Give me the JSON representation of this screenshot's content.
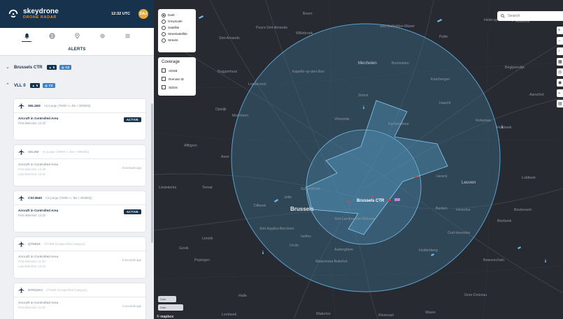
{
  "brand": {
    "name": "skeydrone",
    "sub": "DRONE RADAR"
  },
  "header": {
    "clock": "12:32 UTC",
    "avatar": "DAJ"
  },
  "nav": [
    {
      "icon": "bell-icon"
    },
    {
      "icon": "globe-icon"
    },
    {
      "icon": "pin-icon"
    },
    {
      "icon": "gear-icon"
    },
    {
      "icon": "menu-icon"
    }
  ],
  "alerts_title": "ALERTS",
  "groups": [
    {
      "name": "Brussels CTR",
      "count": "6",
      "cz": "CZ"
    },
    {
      "name": "VLL 0",
      "count": "5",
      "cz": "CZ"
    }
  ],
  "alerts": [
    {
      "callsign": "SEL1ED",
      "category": "A3 (Large (75000 <= lbs < 300000))",
      "type": "Aircraft in Controlled Area",
      "line1": "First detection: 12:22",
      "line2": "",
      "status": "ACTIVE",
      "ago": ""
    },
    {
      "callsign": "SEL8M",
      "category": "A3 (Large (75000 <= lbs < 300000))",
      "type": "Aircraft in Controlled Area",
      "line1": "First detection: 12:28",
      "line2": "Last detection: 12:32",
      "status": "",
      "ago": "6 seconds ago"
    },
    {
      "callsign": "CSC3640",
      "category": "A3 (Large (75000 <= lbs < 300000))",
      "type": "Aircraft in Controlled Area",
      "line1": "First detection: 12:22",
      "line2": "",
      "status": "ACTIVE",
      "ago": ""
    },
    {
      "callsign": "QTN61K",
      "category": "OTHER (Unspecified Category)",
      "type": "Aircraft in Controlled Area",
      "line1": "First detection: 11:33",
      "line2": "Last detection: 12:33",
      "status": "",
      "ago": "5 seconds ago"
    },
    {
      "callsign": "RYR22KV",
      "category": "OTHER (Unspecified Category)",
      "type": "Aircraft in Controlled Area",
      "line1": "First detection: 11:48",
      "line2": "",
      "status": "",
      "ago": "4 seconds ago"
    }
  ],
  "map_style": {
    "options": [
      "Dark",
      "Greyscale",
      "Satellite",
      "Streetsatellite",
      "Streets"
    ],
    "selected": "Dark"
  },
  "coverage": {
    "title": "Coverage",
    "options": [
      "ADSB",
      "Remote ID",
      "SDDS"
    ]
  },
  "search": {
    "placeholder": "Search"
  },
  "tools": [
    "+",
    "−",
    "↑",
    "▦",
    "◎",
    "◉",
    "⌁",
    "▤"
  ],
  "timechips": [
    "Date",
    "Date"
  ],
  "map_labels": {
    "big": [
      "Brussels",
      "Leuven",
      "Mechelen"
    ],
    "places": [
      "Boom",
      "Puurs-Sint-Amands",
      "Willebroek",
      "Sint-Kathelijne-Waver",
      "Putte",
      "Heist-op-den-Berg",
      "Hulshout",
      "Sint-Amands",
      "Buggenhout",
      "Kapelle-op-den-Bos",
      "Londerzeel",
      "Bonheiden",
      "Keerbergen",
      "Begijnendijk",
      "Aarschot",
      "Opwijk",
      "Merchtem",
      "Zemst",
      "Haacht",
      "Rotselaar",
      "Holsbeek",
      "Vilvoorde",
      "Kampenhout",
      "Affligem",
      "Asse",
      "Liedekerke",
      "Ternat",
      "Dilbeek",
      "Sint-Agatha-Berchem",
      "Jette",
      "Schaerbeek",
      "Herent",
      "Bertem",
      "Heverlee",
      "Lubbeek",
      "Ixelles",
      "Sint-Lambrechts-Woluwe",
      "Oud-Heverlee",
      "Bierbeek",
      "Boutersem",
      "Auderghem",
      "Uccle",
      "Waterméal-Boitsfort",
      "Huldenberg",
      "Beauvechain",
      "Pepingen",
      "Halle",
      "Grez-Doiceau",
      "Lembeek",
      "Waterloo",
      "Rixensart",
      "Wavre",
      "Lennik",
      "Gooik"
    ],
    "ctr": "Brussels CTR"
  },
  "mapbox": "© mapbox"
}
